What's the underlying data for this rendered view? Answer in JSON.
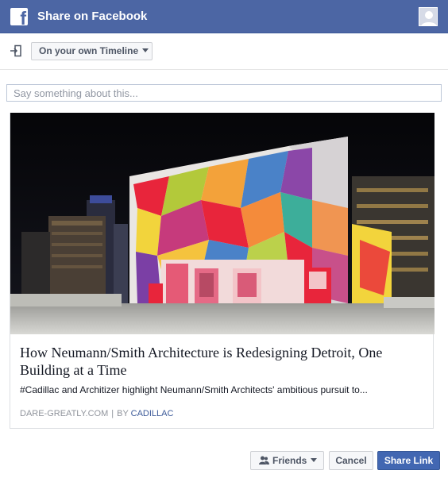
{
  "header": {
    "title": "Share on Facebook",
    "logo_letter": "f",
    "logo_icon": "facebook-logo-icon",
    "avatar_icon": "user-avatar-icon",
    "background_color": "#4c66a4"
  },
  "toolbar": {
    "share_icon": "share-to-icon",
    "destination_label": "On your own Timeline"
  },
  "composer": {
    "placeholder": "Say something about this...",
    "value": ""
  },
  "link_preview": {
    "image": "building-with-colorful-geometric-mural-at-night",
    "title": "How Neumann/Smith Architecture is Redesigning Detroit, One Building at a Time",
    "description": "#Cadillac and Architizer highlight Neumann/Smith Architects' ambitious pursuit to...",
    "domain": "DARE-GREATLY.COM",
    "separator": "|",
    "by_label": "BY",
    "author": "CADILLAC",
    "author_color": "#3b5998"
  },
  "footer": {
    "audience_icon": "friends-icon",
    "audience_label": "Friends",
    "cancel_label": "Cancel",
    "share_label": "Share Link",
    "share_color": "#4267b2"
  }
}
